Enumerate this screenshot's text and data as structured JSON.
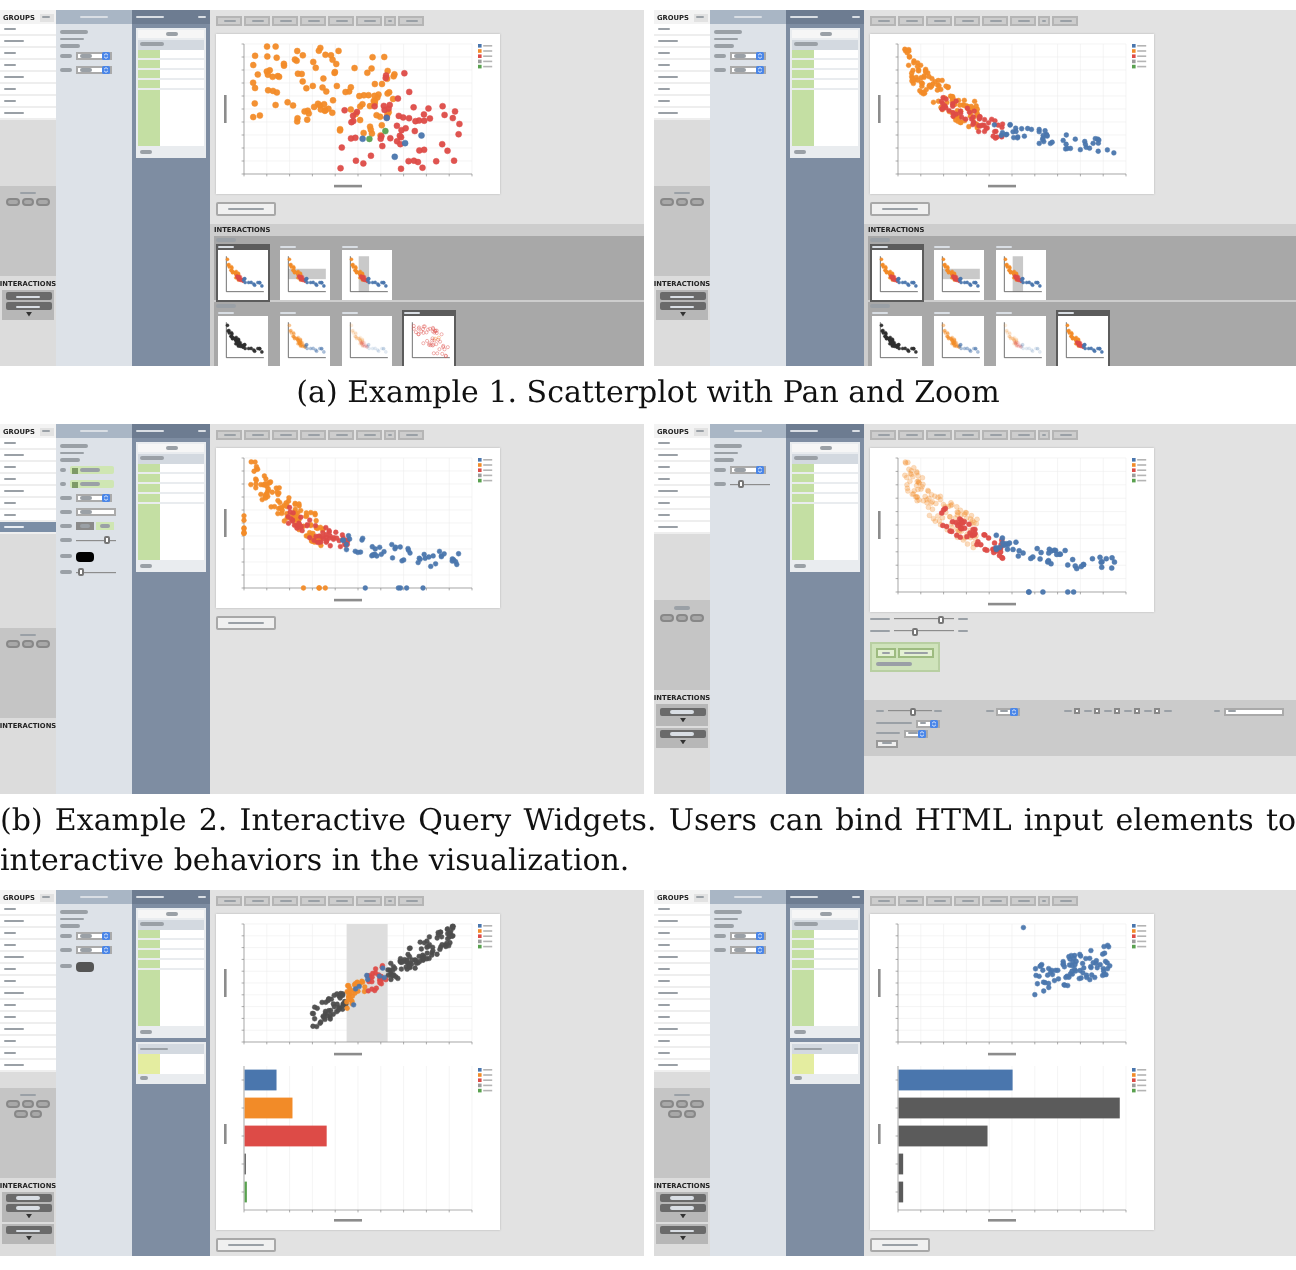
{
  "rows": [
    {
      "panels": [
        {
          "groups": {
            "heading": "GROUPS",
            "items": [
              {
                "selected": false
              },
              {
                "selected": false
              },
              {
                "selected": false
              },
              {
                "selected": false
              },
              {
                "selected": false
              },
              {
                "selected": false
              },
              {
                "selected": false
              },
              {
                "selected": false
              }
            ]
          },
          "interactions": {
            "heading": "INTERACTIONS",
            "cards": [
              {
                "kind": "double"
              }
            ]
          },
          "properties": {
            "controls": [
              {
                "kind": "select"
              },
              {
                "kind": "select"
              }
            ]
          },
          "pipelines": {
            "tables": [
              {
                "kind": "fields"
              }
            ]
          },
          "chart": {
            "kind": "spread"
          },
          "export_button": true,
          "tray": {
            "heading": "INTERACTIONS",
            "rows": [
              {
                "thumbnails": [
                  {
                    "kind": "plain",
                    "selected": true
                  },
                  {
                    "kind": "band_h",
                    "selected": false
                  },
                  {
                    "kind": "band_v",
                    "selected": false
                  }
                ]
              },
              {
                "thumbnails": [
                  {
                    "kind": "dark",
                    "selected": false
                  },
                  {
                    "kind": "faded",
                    "selected": false
                  },
                  {
                    "kind": "pale",
                    "selected": false
                  },
                  {
                    "kind": "spread",
                    "selected": true
                  }
                ]
              }
            ]
          }
        },
        {
          "groups": {
            "heading": "GROUPS",
            "items": [
              {
                "selected": false
              },
              {
                "selected": false
              },
              {
                "selected": false
              },
              {
                "selected": false
              },
              {
                "selected": false
              },
              {
                "selected": false
              },
              {
                "selected": false
              },
              {
                "selected": false
              }
            ]
          },
          "interactions": {
            "heading": "INTERACTIONS",
            "cards": [
              {
                "kind": "double"
              }
            ]
          },
          "properties": {
            "controls": [
              {
                "kind": "select"
              },
              {
                "kind": "select"
              }
            ]
          },
          "pipelines": {
            "tables": [
              {
                "kind": "fields"
              }
            ]
          },
          "chart": {
            "kind": "trend"
          },
          "export_button": true,
          "tray": {
            "heading": "INTERACTIONS",
            "rows": [
              {
                "thumbnails": [
                  {
                    "kind": "plain",
                    "selected": true
                  },
                  {
                    "kind": "band_h",
                    "selected": false
                  },
                  {
                    "kind": "band_v",
                    "selected": false
                  }
                ]
              },
              {
                "thumbnails": [
                  {
                    "kind": "dark",
                    "selected": false
                  },
                  {
                    "kind": "faded",
                    "selected": false
                  },
                  {
                    "kind": "pale",
                    "selected": false
                  },
                  {
                    "kind": "plain",
                    "selected": true
                  }
                ]
              }
            ]
          }
        }
      ],
      "caption": "(a) Example 1. Scatterplot with Pan and Zoom"
    },
    {
      "panels": [
        {
          "groups": {
            "heading": "GROUPS",
            "items": [
              {
                "selected": false
              },
              {
                "selected": false
              },
              {
                "selected": false
              },
              {
                "selected": false
              },
              {
                "selected": false
              },
              {
                "selected": false
              },
              {
                "selected": false
              },
              {
                "selected": true
              }
            ]
          },
          "interactions": {
            "heading": "INTERACTIONS"
          },
          "properties": {
            "controls": [
              {
                "kind": "token"
              },
              {
                "kind": "token"
              },
              {
                "kind": "select"
              },
              {
                "kind": "text"
              },
              {
                "kind": "segmented",
                "segments": [
                  {
                    "selected": true
                  },
                  {
                    "selected": false
                  }
                ]
              },
              {
                "kind": "slider",
                "level": 0.8
              },
              {
                "kind": "swatch",
                "color": "#000000"
              },
              {
                "kind": "slider",
                "level": 0.08
              }
            ]
          },
          "pipelines": {
            "tables": [
              {
                "kind": "fields"
              }
            ]
          },
          "chart": {
            "kind": "trend_rug"
          },
          "export_button": true
        },
        {
          "groups": {
            "heading": "GROUPS",
            "items": [
              {
                "selected": false
              },
              {
                "selected": false
              },
              {
                "selected": false
              },
              {
                "selected": false
              },
              {
                "selected": false
              },
              {
                "selected": false
              },
              {
                "selected": false
              },
              {
                "selected": false
              }
            ]
          },
          "interactions": {
            "heading": "INTERACTIONS",
            "cards": [
              {
                "kind": "single"
              },
              {
                "kind": "single"
              }
            ]
          },
          "properties": {
            "controls": [
              {
                "kind": "select"
              },
              {
                "kind": "slider",
                "level": 0.25
              }
            ]
          },
          "pipelines": {
            "tables": [
              {
                "kind": "fields"
              }
            ]
          },
          "chart": {
            "kind": "faded"
          },
          "widgets": {
            "sliders": [
              {
                "level": 0.8
              },
              {
                "level": 0.35
              }
            ],
            "bar": {
              "slider": {
                "level": 0.6
              },
              "checkboxes": [
                {
                  "checked": false
                },
                {
                  "checked": false
                },
                {
                  "checked": false
                },
                {
                  "checked": false
                },
                {
                  "checked": false
                }
              ]
            }
          }
        }
      ],
      "caption": "(b) Example 2. Interactive Query Widgets. Users can bind HTML input elements to interactive behaviors in the visualization."
    },
    {
      "panels": [
        {
          "groups": {
            "heading": "GROUPS",
            "items": [
              {
                "selected": false
              },
              {
                "selected": false
              },
              {
                "selected": false
              },
              {
                "selected": false
              },
              {
                "selected": false
              },
              {
                "selected": false
              },
              {
                "selected": false
              },
              {
                "selected": false
              },
              {
                "selected": false
              },
              {
                "selected": false
              },
              {
                "selected": false
              },
              {
                "selected": false
              },
              {
                "selected": false
              },
              {
                "selected": false
              }
            ]
          },
          "interactions": {
            "heading": "INTERACTIONS",
            "cards": [
              {
                "kind": "double"
              },
              {
                "kind": "single"
              }
            ]
          },
          "properties": {
            "controls": [
              {
                "kind": "select"
              },
              {
                "kind": "select"
              },
              {
                "kind": "swatch",
                "color": "#555555"
              }
            ]
          },
          "pipelines": {
            "tables": [
              {
                "kind": "fields"
              },
              {
                "kind": "aggregate"
              }
            ]
          },
          "chart": {
            "kind": "brush"
          },
          "export_button": true
        },
        {
          "groups": {
            "heading": "GROUPS",
            "items": [
              {
                "selected": false
              },
              {
                "selected": false
              },
              {
                "selected": false
              },
              {
                "selected": false
              },
              {
                "selected": false
              },
              {
                "selected": false
              },
              {
                "selected": false
              },
              {
                "selected": false
              },
              {
                "selected": false
              },
              {
                "selected": false
              },
              {
                "selected": false
              },
              {
                "selected": false
              },
              {
                "selected": false
              },
              {
                "selected": false
              }
            ]
          },
          "interactions": {
            "heading": "INTERACTIONS",
            "cards": [
              {
                "kind": "double"
              },
              {
                "kind": "single"
              }
            ]
          },
          "properties": {
            "controls": [
              {
                "kind": "select"
              },
              {
                "kind": "select"
              }
            ]
          },
          "pipelines": {
            "tables": [
              {
                "kind": "fields"
              },
              {
                "kind": "aggregate"
              }
            ]
          },
          "chart": {
            "kind": "filtered"
          },
          "export_button": true
        }
      ]
    }
  ]
}
